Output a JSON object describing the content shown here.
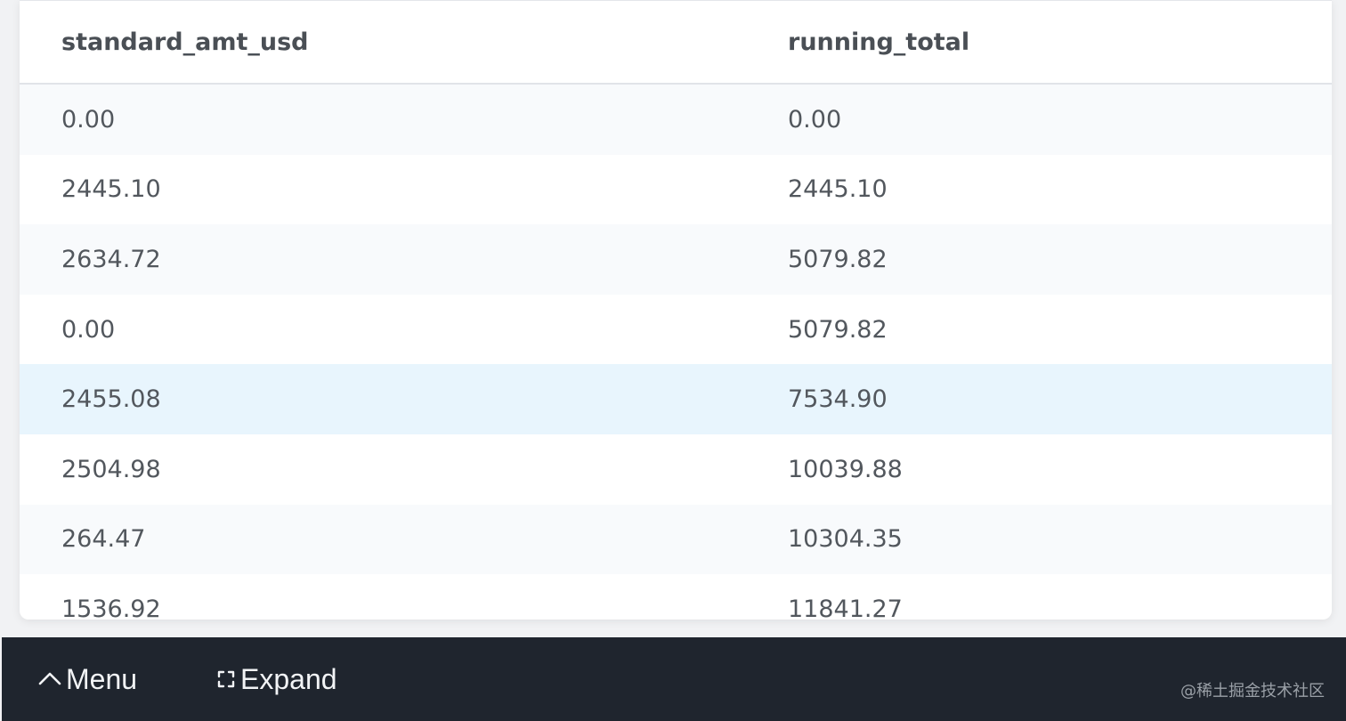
{
  "table": {
    "columns": [
      "standard_amt_usd",
      "running_total"
    ],
    "rows": [
      [
        "0.00",
        "0.00"
      ],
      [
        "2445.10",
        "2445.10"
      ],
      [
        "2634.72",
        "5079.82"
      ],
      [
        "0.00",
        "5079.82"
      ],
      [
        "2455.08",
        "7534.90"
      ],
      [
        "2504.98",
        "10039.88"
      ],
      [
        "264.47",
        "10304.35"
      ],
      [
        "1536.92",
        "11841.27"
      ]
    ]
  },
  "bottombar": {
    "menu_label": "Menu",
    "expand_label": "Expand",
    "menu_icon": "chevron-up-icon",
    "expand_icon": "expand-icon",
    "watermark": "@稀土掘金技术社区"
  },
  "colors": {
    "bar_background": "#1f252e",
    "highlight_row": "#e8f5fd"
  }
}
